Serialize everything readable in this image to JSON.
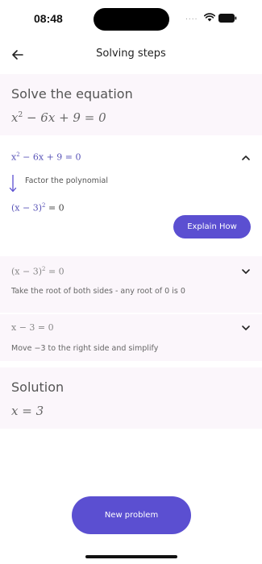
{
  "status_bar": {
    "time": "08:48",
    "signal_dots": "....",
    "wifi_icon": "wifi-icon",
    "battery_icon": "battery-icon"
  },
  "header": {
    "title": "Solving steps",
    "back_icon": "arrow-left-icon"
  },
  "equation": {
    "heading": "Solve the equation",
    "expression_parts": [
      "x",
      "2",
      " − 6x + 9 = 0"
    ]
  },
  "steps": [
    {
      "expression_parts": [
        "x",
        "2",
        " − 6x + 9 = 0"
      ],
      "expanded": true,
      "instruction": "Factor the polynomial",
      "result_parts": [
        "(x − 3)",
        "2",
        " = 0"
      ],
      "explain_label": "Explain How"
    },
    {
      "expression_parts": [
        "(x − 3)",
        "2",
        " = 0"
      ],
      "expanded": false,
      "instruction": "Take the root of both sides - any root of 0 is 0"
    },
    {
      "expression": "x − 3 = 0",
      "expanded": false,
      "instruction": "Move −3 to the right side and simplify"
    }
  ],
  "solution": {
    "heading": "Solution",
    "value": "x = 3"
  },
  "footer": {
    "new_problem_label": "New problem"
  },
  "colors": {
    "accent": "#5b4fd1",
    "card_background": "#fbf6fb",
    "expression_accent": "#5a55b8"
  }
}
